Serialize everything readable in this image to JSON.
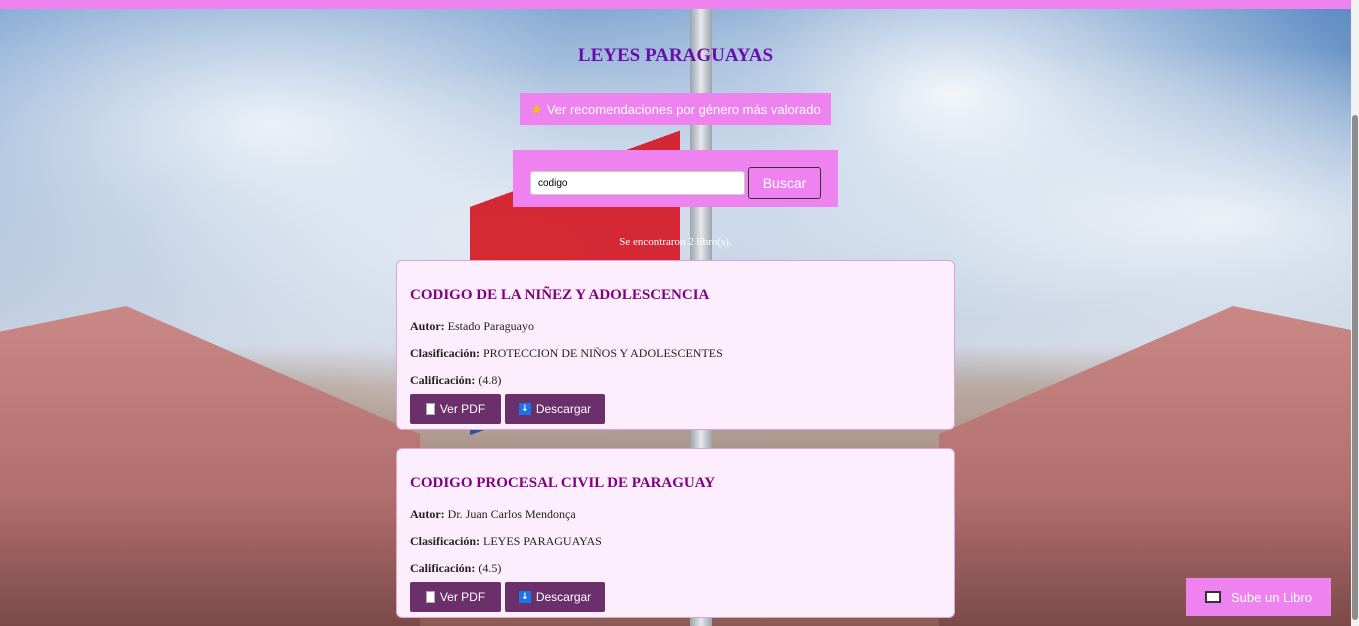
{
  "page": {
    "title": "LEYES PARAGUAYAS",
    "recommend_icon": "star-icon",
    "recommend_label": "Ver recomendaciones por género más valorado",
    "search": {
      "value": "codigo",
      "placeholder": "",
      "button_label": "Buscar"
    },
    "result_count": "Se encontraron 2 libro(s).",
    "upload": {
      "icon": "book-icon",
      "label": "Sube un Libro"
    }
  },
  "labels": {
    "author": "Autor:",
    "classification": "Clasificación:",
    "rating": "Calificación:"
  },
  "books": [
    {
      "title": "CODIGO DE LA NIÑEZ Y ADOLESCENCIA",
      "author": "Estado Paraguayo",
      "classification": "PROTECCION DE NIÑOS Y ADOLESCENTES",
      "rating": "(4.8)",
      "view_label": "Ver PDF",
      "download_label": "Descargar"
    },
    {
      "title": "CODIGO PROCESAL CIVIL DE PARAGUAY",
      "author": "Dr. Juan Carlos Mendonça",
      "classification": "LEYES PARAGUAYAS",
      "rating": "(4.5)",
      "view_label": "Ver PDF",
      "download_label": "Descargar"
    }
  ],
  "colors": {
    "accent": "#ee82ee",
    "title": "#6a0dad",
    "card_title": "#800080",
    "card_bg": "#fdeefd",
    "button_dark": "#6b2f6b"
  }
}
